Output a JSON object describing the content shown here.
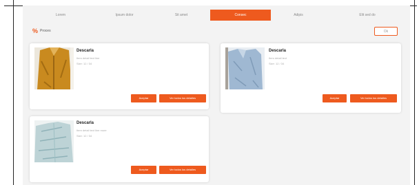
{
  "nav": {
    "tabs": [
      {
        "label": "Lorem"
      },
      {
        "label": "Ipsum dolor"
      },
      {
        "label": "Sit amet"
      },
      {
        "label": "Consec"
      },
      {
        "label": "Adipis"
      },
      {
        "label": "Elit sed do"
      }
    ],
    "active_index": 3
  },
  "section": {
    "title": "Proces"
  },
  "corner_button": {
    "label": "Ok"
  },
  "cards": [
    {
      "title": "Descarla",
      "line1": "Item detail text line",
      "line2": "Size: 12 / 34",
      "btn1": "Aceptar",
      "btn2": "Ver todos los detalles"
    },
    {
      "title": "Descarla",
      "line1": "Item detail text",
      "line2": "Size: 12 / 34",
      "btn1": "Aceptar",
      "btn2": "Ver todos los detalles"
    },
    {
      "title": "Descarla",
      "line1": "Item detail text line more",
      "line2": "Size: 12 / 34",
      "btn1": "Aceptar",
      "btn2": "Ver todos los detalles"
    }
  ],
  "colors": {
    "accent": "#ee5a1e",
    "panel": "#f3f3f3"
  }
}
